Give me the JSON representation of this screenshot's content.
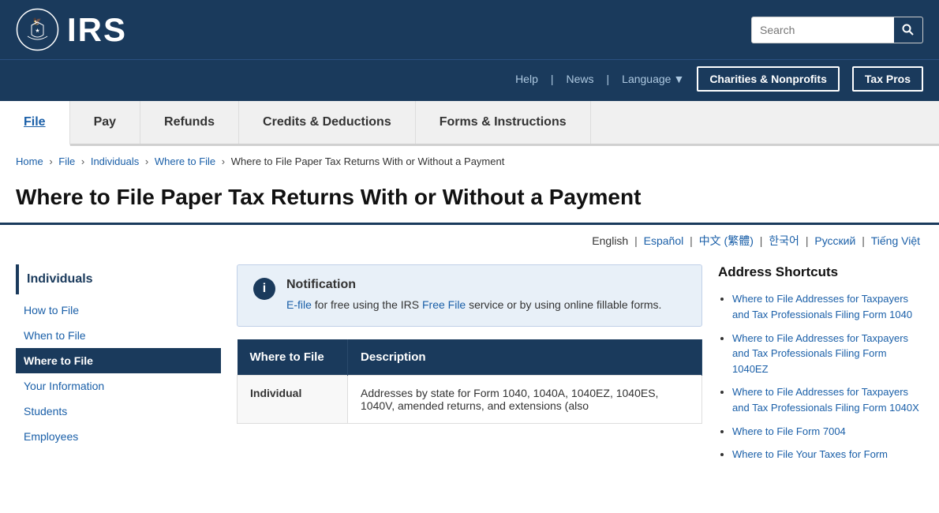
{
  "header": {
    "logo_text": "IRS",
    "search_placeholder": "Search",
    "nav_help": "Help",
    "nav_news": "News",
    "nav_language": "Language",
    "btn_charities": "Charities & Nonprofits",
    "btn_tax_pros": "Tax Pros"
  },
  "main_nav": [
    {
      "label": "File",
      "active": true
    },
    {
      "label": "Pay",
      "active": false
    },
    {
      "label": "Refunds",
      "active": false
    },
    {
      "label": "Credits & Deductions",
      "active": false
    },
    {
      "label": "Forms & Instructions",
      "active": false
    }
  ],
  "breadcrumb": [
    {
      "label": "Home",
      "link": true
    },
    {
      "label": "File",
      "link": true
    },
    {
      "label": "Individuals",
      "link": true
    },
    {
      "label": "Where to File",
      "link": true
    },
    {
      "label": "Where to File Paper Tax Returns With or Without a Payment",
      "link": false
    }
  ],
  "page_title": "Where to File Paper Tax Returns With or Without a Payment",
  "languages": [
    {
      "label": "English",
      "current": true
    },
    {
      "label": "Español"
    },
    {
      "label": "中文 (繁體)"
    },
    {
      "label": "한국어"
    },
    {
      "label": "Русский"
    },
    {
      "label": "Tiếng Việt"
    }
  ],
  "sidebar": {
    "section_title": "Individuals",
    "items": [
      {
        "label": "How to File",
        "active": false
      },
      {
        "label": "When to File",
        "active": false
      },
      {
        "label": "Where to File",
        "active": true
      },
      {
        "label": "Your Information",
        "active": false
      },
      {
        "label": "Students",
        "active": false
      },
      {
        "label": "Employees",
        "active": false
      }
    ]
  },
  "notification": {
    "title": "Notification",
    "text_before_link1": "",
    "link1": "E-file",
    "text_middle": " for free using the IRS ",
    "link2": "Free File",
    "text_after": " service or by using online fillable forms."
  },
  "table": {
    "columns": [
      "Where to File",
      "Description"
    ],
    "rows": [
      {
        "col1": "Individual",
        "col2": "Addresses by state for Form 1040, 1040A, 1040EZ, 1040ES, 1040V, amended returns, and extensions (also"
      }
    ]
  },
  "address_shortcuts": {
    "title": "Address Shortcuts",
    "links": [
      "Where to File Addresses for Taxpayers and Tax Professionals Filing Form 1040",
      "Where to File Addresses for Taxpayers and Tax Professionals Filing Form 1040EZ",
      "Where to File Addresses for Taxpayers and Tax Professionals Filing Form 1040X",
      "Where to File Form 7004",
      "Where to File Your Taxes for Form"
    ]
  }
}
